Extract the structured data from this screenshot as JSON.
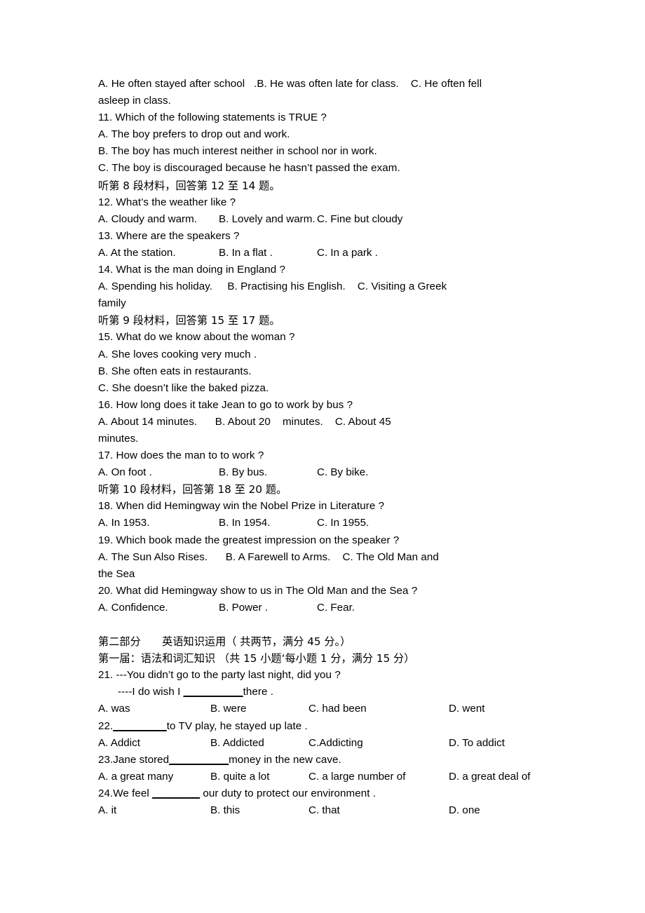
{
  "document": {
    "page_kind": "english-exam-paper",
    "listening_options_line_1": {
      "a": "A. He often stayed after school",
      "b": ".B. He was often late for class.",
      "c": "C. He often fell",
      "tail": "asleep in class."
    },
    "q11": {
      "stem": "11. Which of the following statements is TRUE ?",
      "a": "A. The boy prefers to drop out and work.",
      "b": "B. The boy has much interest neither in school nor in work.",
      "c": "C. The boy is discouraged because he hasn’t passed the exam."
    },
    "cn_direction_8": "听第 8 段材料，回答第 12 至 14 题。",
    "q12": {
      "stem": "12. What’s the weather like ?",
      "a": "A. Cloudy and warm.",
      "b": "B. Lovely and warm.",
      "c": "C. Fine but cloudy"
    },
    "q13": {
      "stem": "13. Where are the speakers ?",
      "a": "A. At the station.",
      "b": "B. In a flat .",
      "c": "C. In a park ."
    },
    "q14": {
      "stem": "14. What is the man doing in England ?",
      "a": "A. Spending his holiday.",
      "b": "B. Practising his English.",
      "c": "C. Visiting a Greek",
      "tail": "family"
    },
    "cn_direction_9": "听第 9 段材料，回答第 15 至 17 题。",
    "q15": {
      "stem": "15. What do we know about the woman ?",
      "a": "A. She loves cooking very much .",
      "b": "B. She often eats in restaurants.",
      "c": "C. She doesn’t like the baked pizza."
    },
    "q16": {
      "stem": "16. How long does it take Jean to go to work by bus ?",
      "a": "A. About 14 minutes.",
      "b": "B. About 20    minutes.",
      "c": "C. About 45",
      "tail": "minutes."
    },
    "q17": {
      "stem": "17. How does the man to to work ?",
      "a": "A. On foot .",
      "b": "B. By bus.",
      "c": "C. By bike."
    },
    "cn_direction_10": "听第 10 段材料，回答第 18 至 20 题。",
    "q18": {
      "stem": "18. When did Hemingway win the Nobel Prize in Literature ?",
      "a": "A. In 1953.",
      "b": "B. In 1954.",
      "c": "C. In 1955."
    },
    "q19": {
      "stem": "19. Which book made the greatest impression on the speaker ?",
      "a": "A. The Sun Also Rises.",
      "b": "B. A Farewell to Arms.",
      "c": "C. The Old Man and",
      "tail": "the Sea"
    },
    "q20": {
      "stem": "20. What did Hemingway show to us in The Old Man and the Sea ?",
      "a": "A. Confidence.",
      "b": "B. Power .",
      "c": "C. Fear."
    },
    "part_two_heading": "第二部分　　英语知识运用（ 共两节，满分 45 分。）",
    "section_one_heading": "第一届：语法和词汇知识 （共 15 小题‘每小题 1 分，满分 15 分）",
    "q21": {
      "stem": "21. ---You didn’t go to the party last night, did you ?",
      "stem2_pre": "----I do wish I ",
      "stem2_blank": "__________",
      "stem2_post": "there .",
      "a": "A. was",
      "b": "B. were",
      "c": "C. had been",
      "d": "D. went"
    },
    "q22": {
      "stem_pre": "22.",
      "stem_blank": "_________",
      "stem_post": "to TV play, he stayed up late .",
      "a": "A. Addict",
      "b": "B. Addicted",
      "c": "C.Addicting",
      "d": "D. To addict"
    },
    "q23": {
      "stem_pre": "23.Jane stored",
      "stem_blank": "__________",
      "stem_post": "money in the new cave.",
      "a": "A. a great many",
      "b": "B. quite a lot",
      "c": "C. a large number of",
      "d": "D. a great deal of"
    },
    "q24": {
      "stem_pre": "24.We feel ",
      "stem_blank": "________",
      "stem_post": " our duty to protect our environment .",
      "a": "A. it",
      "b": "B. this",
      "c": "C. that",
      "d": "D. one"
    }
  }
}
